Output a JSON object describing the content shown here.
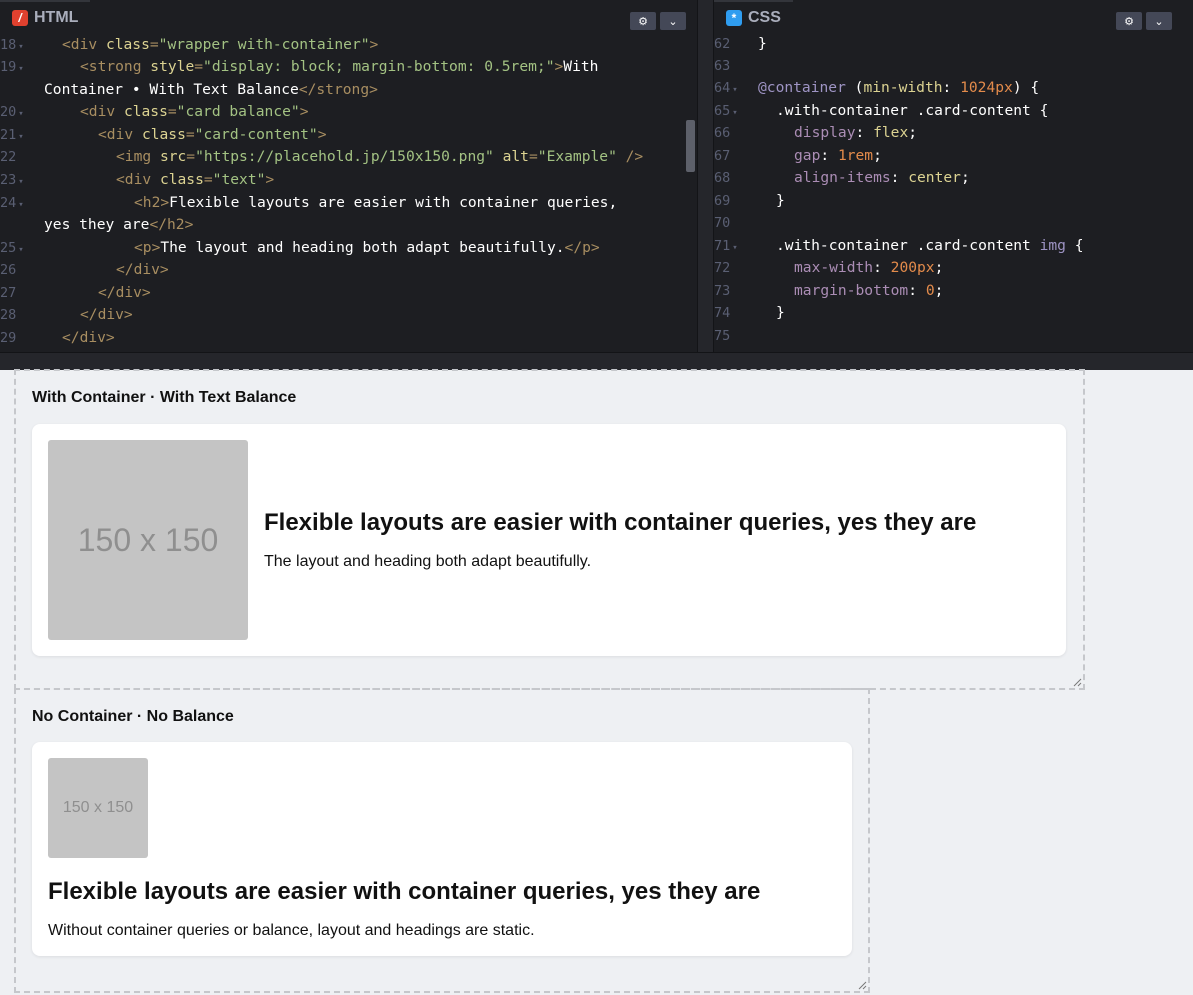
{
  "editor": {
    "html_pane": {
      "tab_label": "HTML",
      "badge": "/",
      "settings_icon": "gear-icon",
      "collapse_icon": "chevron-down-icon"
    },
    "css_pane": {
      "tab_label": "CSS",
      "badge": "*",
      "settings_icon": "gear-icon",
      "collapse_icon": "chevron-down-icon"
    },
    "html_lines": [
      {
        "n": "18",
        "fold": true
      },
      {
        "n": "19",
        "fold": true
      },
      {
        "n": "",
        "fold": false
      },
      {
        "n": "20",
        "fold": true
      },
      {
        "n": "21",
        "fold": true
      },
      {
        "n": "22",
        "fold": false
      },
      {
        "n": "23",
        "fold": true
      },
      {
        "n": "24",
        "fold": true
      },
      {
        "n": "",
        "fold": false
      },
      {
        "n": "25",
        "fold": true
      },
      {
        "n": "26",
        "fold": false
      },
      {
        "n": "27",
        "fold": false
      },
      {
        "n": "28",
        "fold": false
      },
      {
        "n": "29",
        "fold": false
      }
    ],
    "html_code": {
      "l18": {
        "t1": "<div ",
        "a1": "class",
        "t2": "=",
        "s1": "\"wrapper with-container\"",
        "t3": ">"
      },
      "l19": {
        "t1": "<strong ",
        "a1": "style",
        "t2": "=",
        "s1": "\"display: block; margin-bottom: 0.5rem;\"",
        "t3": ">",
        "x": "With"
      },
      "l19b": {
        "x": "Container • With Text Balance",
        "t1": "</strong>"
      },
      "l20": {
        "t1": "<div ",
        "a1": "class",
        "t2": "=",
        "s1": "\"card balance\"",
        "t3": ">"
      },
      "l21": {
        "t1": "<div ",
        "a1": "class",
        "t2": "=",
        "s1": "\"card-content\"",
        "t3": ">"
      },
      "l22": {
        "t1": "<img ",
        "a1": "src",
        "t2": "=",
        "s1": "\"https://placehold.jp/150x150.png\"",
        "a2": " alt",
        "t3": "=",
        "s2": "\"Example\"",
        "t4": " />"
      },
      "l23": {
        "t1": "<div ",
        "a1": "class",
        "t2": "=",
        "s1": "\"text\"",
        "t3": ">"
      },
      "l24": {
        "t1": "<h2>",
        "x": "Flexible layouts are easier with container queries,"
      },
      "l24b": {
        "x": "yes they are",
        "t1": "</h2>"
      },
      "l25": {
        "t1": "<p>",
        "x": "The layout and heading both adapt beautifully.",
        "t2": "</p>"
      },
      "l26": {
        "t1": "</div>"
      },
      "l27": {
        "t1": "</div>"
      },
      "l28": {
        "t1": "</div>"
      },
      "l29": {
        "t1": "</div>"
      }
    },
    "css_lines": [
      "62",
      "63",
      "64",
      "65",
      "66",
      "67",
      "68",
      "69",
      "70",
      "71",
      "72",
      "73",
      "74",
      "75"
    ],
    "css_code": {
      "l62": "}",
      "l64": {
        "kw": "@container",
        "p1": " (",
        "pr": "min-width",
        "p2": ": ",
        "nm": "1024px",
        "p3": ") {"
      },
      "l65": ".with-container .card-content {",
      "l66": {
        "pr": "display",
        "p": ": ",
        "v": "flex",
        "e": ";"
      },
      "l67": {
        "pr": "gap",
        "p": ": ",
        "v": "1rem",
        "e": ";"
      },
      "l68": {
        "pr": "align-items",
        "p": ": ",
        "v": "center",
        "e": ";"
      },
      "l69": "}",
      "l71": {
        "sel": ".with-container .card-content ",
        "tag": "img",
        "e": " {"
      },
      "l72": {
        "pr": "max-width",
        "p": ": ",
        "v": "200px",
        "e": ";"
      },
      "l73": {
        "pr": "margin-bottom",
        "p": ": ",
        "v": "0",
        "e": ";"
      },
      "l74": "}"
    }
  },
  "preview": {
    "section1": {
      "title": "With Container · With Text Balance",
      "placeholder": "150 x 150",
      "heading": "Flexible layouts are easier with container queries, yes they are",
      "paragraph": "The layout and heading both adapt beautifully."
    },
    "section2": {
      "title": "No Container · No Balance",
      "placeholder": "150 x 150",
      "heading": "Flexible layouts are easier with container queries, yes they are",
      "paragraph": "Without container queries or balance, layout and headings are static."
    }
  }
}
